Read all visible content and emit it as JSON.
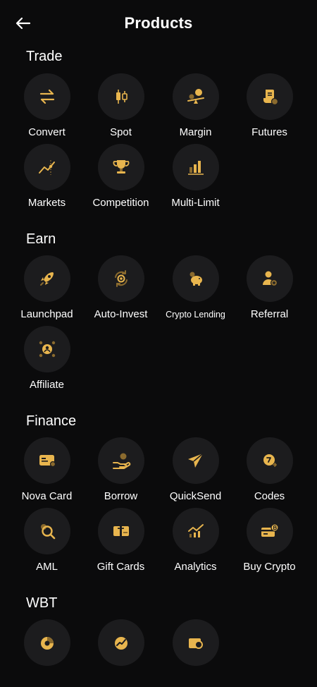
{
  "header": {
    "title": "Products",
    "back_icon": "arrow-left-icon"
  },
  "accent": "#e8b54e",
  "sections": {
    "trade": {
      "title": "Trade",
      "items": [
        {
          "label": "Convert",
          "icon": "swap-arrows-icon"
        },
        {
          "label": "Spot",
          "icon": "candlestick-icon"
        },
        {
          "label": "Margin",
          "icon": "balance-coin-icon"
        },
        {
          "label": "Futures",
          "icon": "contract-document-icon"
        },
        {
          "label": "Markets",
          "icon": "trend-line-icon"
        },
        {
          "label": "Competition",
          "icon": "trophy-icon"
        },
        {
          "label": "Multi-Limit",
          "icon": "bar-chart-icon"
        }
      ]
    },
    "earn": {
      "title": "Earn",
      "items": [
        {
          "label": "Launchpad",
          "icon": "rocket-icon"
        },
        {
          "label": "Auto-Invest",
          "icon": "auto-cycle-icon"
        },
        {
          "label": "Crypto Lending",
          "icon": "piggy-bank-icon"
        },
        {
          "label": "Referral",
          "icon": "user-add-icon"
        },
        {
          "label": "Affiliate",
          "icon": "network-user-icon"
        }
      ]
    },
    "finance": {
      "title": "Finance",
      "items": [
        {
          "label": "Nova Card",
          "icon": "card-icon"
        },
        {
          "label": "Borrow",
          "icon": "hand-coin-icon"
        },
        {
          "label": "QuickSend",
          "icon": "paper-plane-icon"
        },
        {
          "label": "Codes",
          "icon": "coin-code-icon"
        },
        {
          "label": "AML",
          "icon": "magnifier-icon"
        },
        {
          "label": "Gift Cards",
          "icon": "gift-card-icon"
        },
        {
          "label": "Analytics",
          "icon": "analytics-icon"
        },
        {
          "label": "Buy Crypto",
          "icon": "card-bitcoin-icon"
        }
      ]
    },
    "wbt": {
      "title": "WBT",
      "items": [
        {
          "icon": "pie-chart-icon"
        },
        {
          "icon": "growth-circle-icon"
        },
        {
          "icon": "wallet-search-icon"
        }
      ]
    }
  }
}
